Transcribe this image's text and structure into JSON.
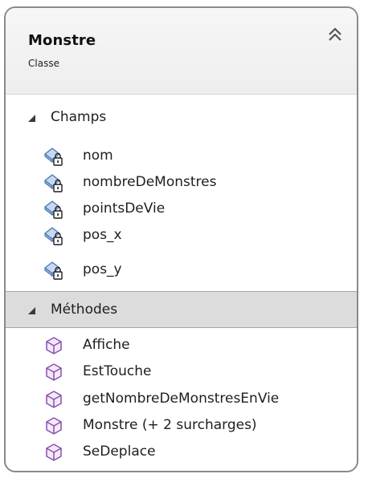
{
  "class": {
    "name": "Monstre",
    "stereotype": "Classe"
  },
  "icons": {
    "collapse": "double-chevron-up-icon",
    "field": "field-private-icon",
    "method": "method-icon",
    "section_toggle": "triangle-down-icon"
  },
  "colors": {
    "border": "#8a8a8a",
    "header_bg": "#f2f2f2",
    "selected_section_bg": "#dcdcdc",
    "field_icon": "#4a78b8",
    "method_icon": "#8a4fb0"
  },
  "sections": {
    "fields": {
      "label": "Champs",
      "items": [
        {
          "label": "nom"
        },
        {
          "label": "nombreDeMonstres"
        },
        {
          "label": "pointsDeVie"
        },
        {
          "label": "pos_x"
        },
        {
          "label": "pos_y"
        }
      ]
    },
    "methods": {
      "label": "Méthodes",
      "items": [
        {
          "label": "Affiche"
        },
        {
          "label": "EstTouche"
        },
        {
          "label": "getNombreDeMonstresEnVie"
        },
        {
          "label": "Monstre (+ 2 surcharges)"
        },
        {
          "label": "SeDeplace"
        }
      ]
    }
  }
}
